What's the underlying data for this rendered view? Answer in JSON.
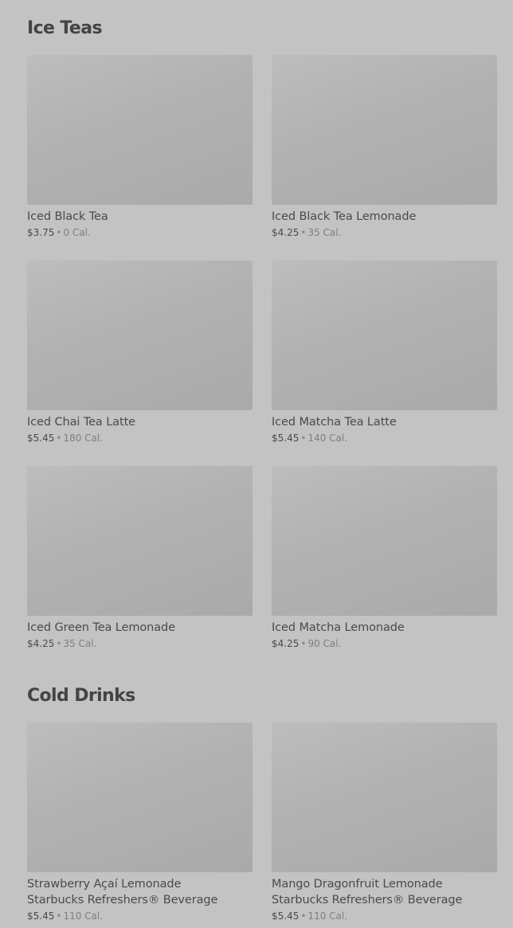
{
  "sections": [
    {
      "title": "Ice Teas",
      "items": [
        {
          "name": "Iced Black Tea",
          "price": "$3.75",
          "separator": "•",
          "calories": "0 Cal."
        },
        {
          "name": "Iced Black Tea Lemonade",
          "price": "$4.25",
          "separator": "•",
          "calories": "35 Cal."
        },
        {
          "name": "Iced Chai Tea Latte",
          "price": "$5.45",
          "separator": "•",
          "calories": "180 Cal."
        },
        {
          "name": "Iced Matcha Tea Latte",
          "price": "$5.45",
          "separator": "•",
          "calories": "140 Cal."
        },
        {
          "name": "Iced Green Tea Lemonade",
          "price": "$4.25",
          "separator": "•",
          "calories": "35 Cal."
        },
        {
          "name": "Iced Matcha Lemonade",
          "price": "$4.25",
          "separator": "•",
          "calories": "90 Cal."
        }
      ]
    },
    {
      "title": "Cold Drinks",
      "items": [
        {
          "name_line1": "Strawberry Açaí Lemonade",
          "name_line2": "Starbucks Refreshers® Beverage",
          "price": "$5.45",
          "separator": "•",
          "calories": "110 Cal."
        },
        {
          "name_line1": "Mango Dragonfruit Lemonade",
          "name_line2": "Starbucks Refreshers® Beverage",
          "price": "$5.45",
          "separator": "•",
          "calories": "110 Cal."
        }
      ]
    }
  ]
}
